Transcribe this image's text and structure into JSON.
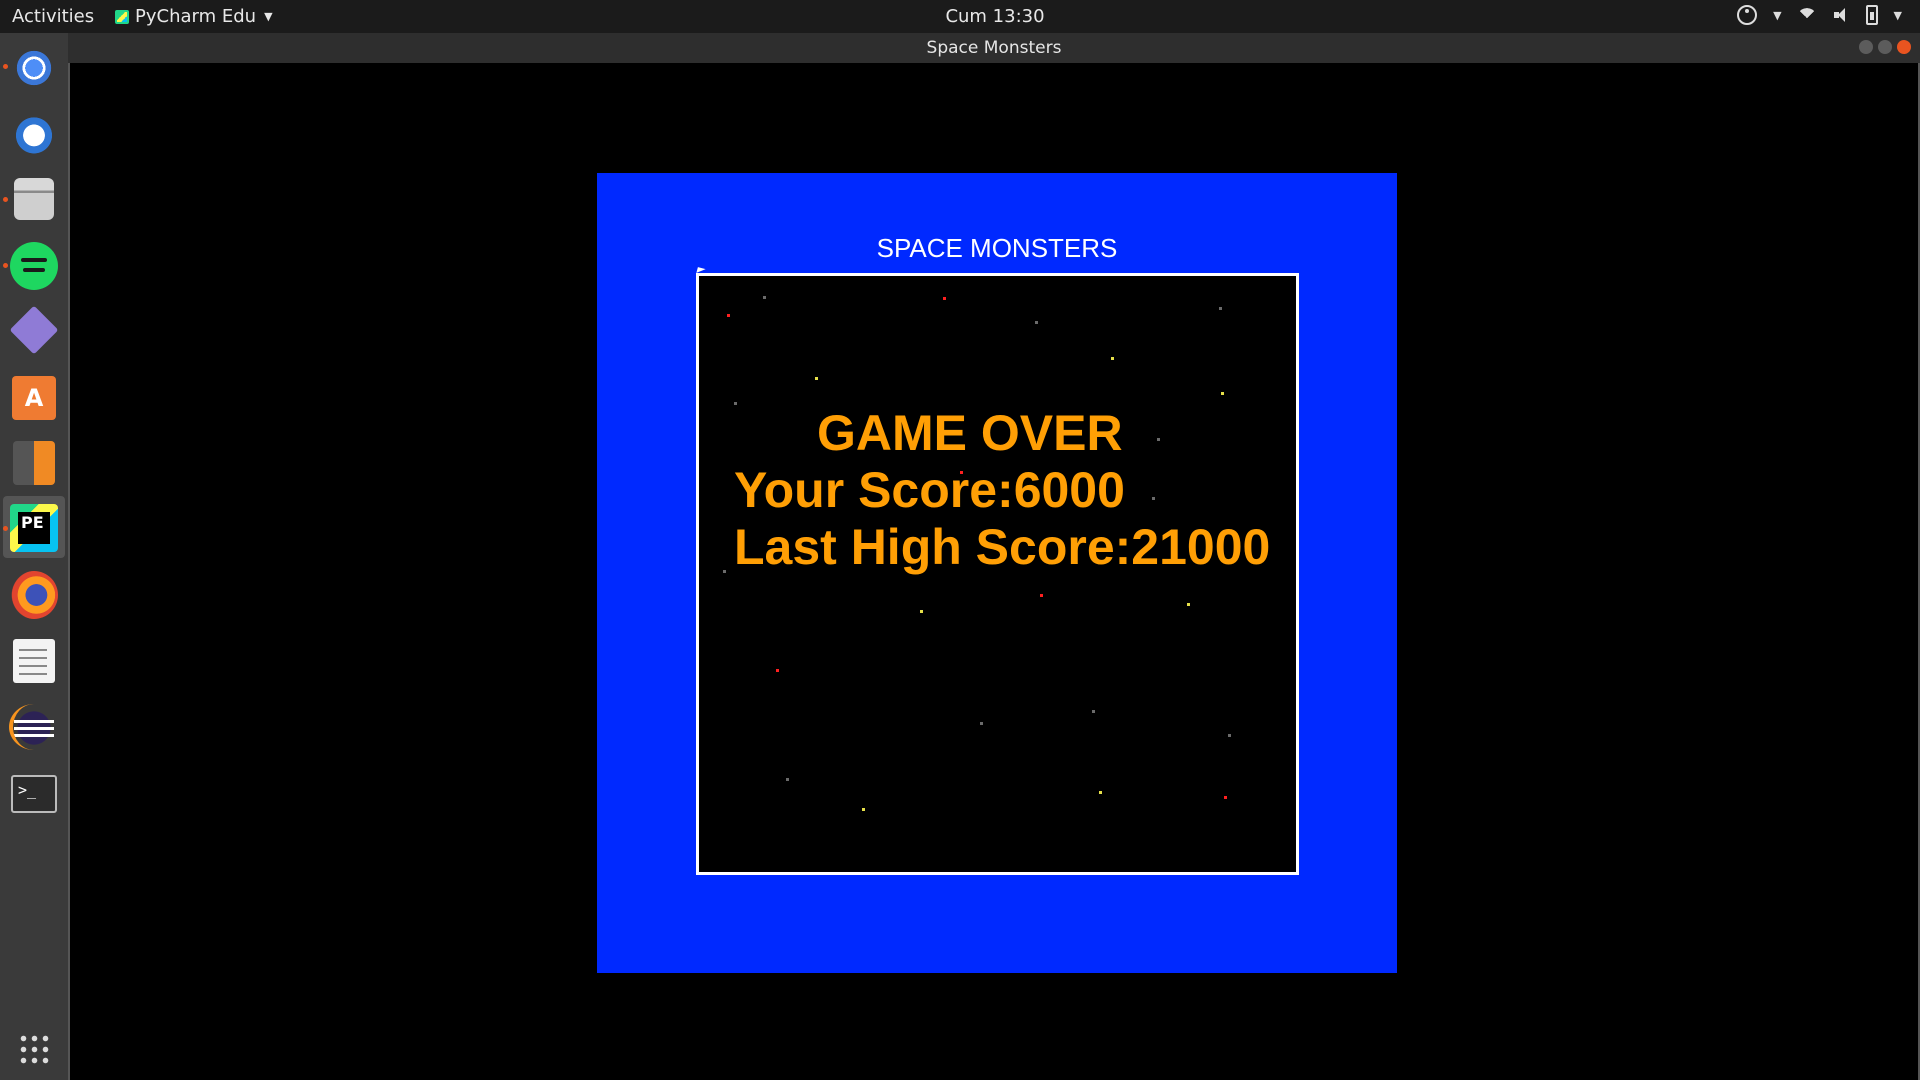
{
  "topbar": {
    "activities": "Activities",
    "app_name": "PyCharm Edu",
    "clock": "Cum 13:30"
  },
  "dock": {
    "items": [
      "chrome-icon",
      "thunderbird-icon",
      "files-icon",
      "spotify-icon",
      "diamond-app-icon",
      "software-store-icon",
      "calculator-icon",
      "pycharm-edu-icon",
      "firefox-icon",
      "text-editor-icon",
      "eclipse-icon",
      "terminal-icon"
    ]
  },
  "window": {
    "title": "Space Monsters"
  },
  "game": {
    "heading": "SPACE MONSTERS",
    "game_over": "GAME OVER",
    "score_line": "Your Score:6000",
    "high_score_line": "Last High Score:21000",
    "colors": {
      "background": "#0029ff",
      "playfield": "#000000",
      "text": "#ff9f05",
      "star_red": "#ff2020",
      "star_yellow": "#e6e04a",
      "star_dim": "#6a6a6a"
    }
  }
}
